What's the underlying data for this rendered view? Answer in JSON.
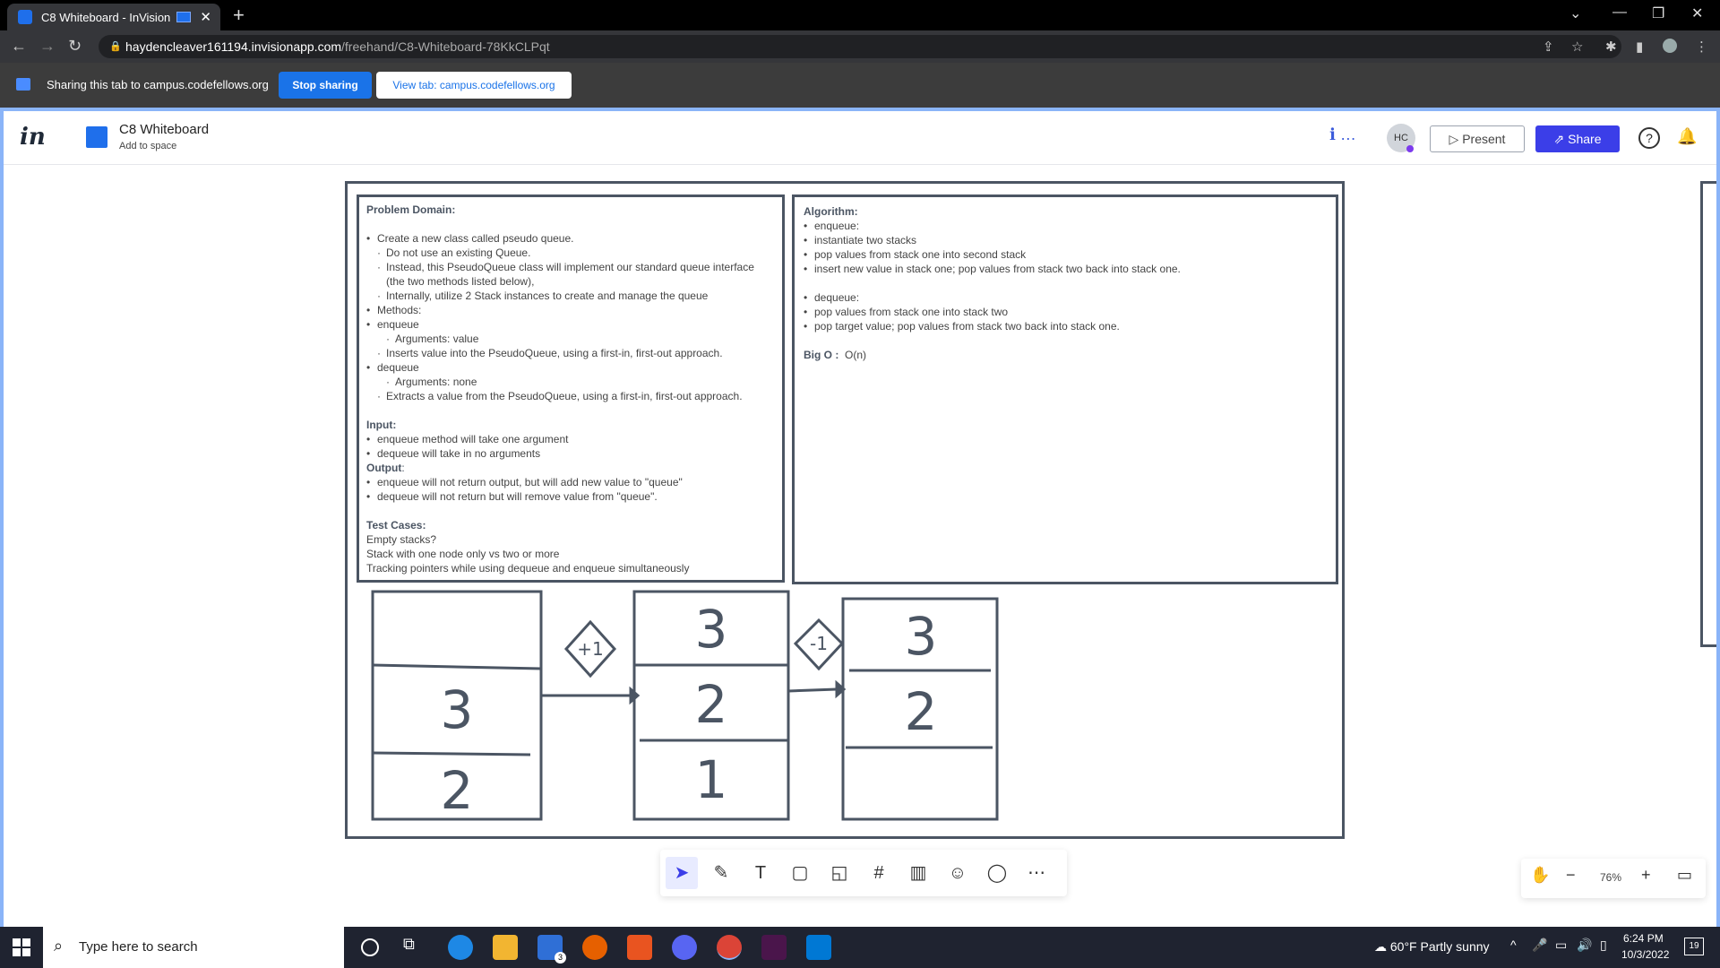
{
  "browser": {
    "tab_title": "C8 Whiteboard - InVision",
    "url_host": "haydencleaver161194.invisionapp.com",
    "url_path": "/freehand/C8-Whiteboard-78KkCLPqt"
  },
  "sharing": {
    "text": "Sharing this tab to campus.codefellows.org",
    "stop_label": "Stop sharing",
    "view_label": "View tab: campus.codefellows.org"
  },
  "app": {
    "logo": "in",
    "board_title": "C8 Whiteboard",
    "board_subtitle": "Add to space",
    "avatar_initials": "HC",
    "present_label": "Present",
    "share_label": "Share",
    "info_label": "ℹ …",
    "help_label": "?"
  },
  "problem": {
    "heading": "Problem Domain:",
    "lines": [
      {
        "lvl": 1,
        "text": "Create a new class called pseudo queue."
      },
      {
        "lvl": 2,
        "text": "Do not use an existing Queue."
      },
      {
        "lvl": 2,
        "text": "Instead, this PseudoQueue class will implement our standard queue interface (the two methods listed below),"
      },
      {
        "lvl": 2,
        "text": "Internally, utilize 2 Stack instances to create and manage the queue"
      },
      {
        "lvl": 1,
        "text": "Methods:"
      },
      {
        "lvl": 1,
        "text": "enqueue"
      },
      {
        "lvl": 3,
        "text": "Arguments: value"
      },
      {
        "lvl": 2,
        "text": "Inserts value into the PseudoQueue, using a first-in, first-out approach."
      },
      {
        "lvl": 1,
        "text": "dequeue"
      },
      {
        "lvl": 3,
        "text": "Arguments: none"
      },
      {
        "lvl": 2,
        "text": "Extracts a value from the PseudoQueue, using a first-in, first-out approach."
      }
    ],
    "input_heading": "Input:",
    "input_lines": [
      "enqueue method will take one argument",
      "dequeue will take in no arguments"
    ],
    "output_heading": "Output",
    "output_lines": [
      "enqueue will not return output, but will add new value to \"queue\"",
      "dequeue will not return but will remove value from \"queue\"."
    ],
    "tests_heading": "Test Cases:",
    "tests_lines": [
      "Empty stacks?",
      "Stack with one node only vs two or more",
      "Tracking pointers while using dequeue and enqueue simultaneously"
    ]
  },
  "algorithm": {
    "heading": "Algorithm:",
    "enqueue_lines": [
      "enqueue:",
      "instantiate two stacks",
      "pop values from stack one into second stack",
      "insert new value in stack one; pop values from stack two back into stack one."
    ],
    "dequeue_lines": [
      "dequeue:",
      "pop values from stack one into stack two",
      "pop target value; pop values from stack two back into stack one."
    ],
    "bigo_label": "Big O :",
    "bigo_value": "O(n)"
  },
  "drawing": {
    "stack1": [
      "",
      "3",
      "2"
    ],
    "op1": "+1",
    "stack2": [
      "3",
      "2",
      "1"
    ],
    "op2": "-1",
    "stack3": [
      "3",
      "2",
      ""
    ]
  },
  "toolbar": {
    "tools": [
      "select-icon",
      "pencil-icon",
      "text-icon",
      "rectangle-icon",
      "sticky-note-icon",
      "frame-icon",
      "chart-icon",
      "sticker-icon",
      "comment-icon",
      "more-icon"
    ],
    "zoom": "76%"
  },
  "taskbar": {
    "search_placeholder": "Type here to search",
    "weather": "60°F  Partly sunny",
    "time": "6:24 PM",
    "date": "10/3/2022",
    "mail_badge": "3",
    "notif_badge": "19"
  }
}
